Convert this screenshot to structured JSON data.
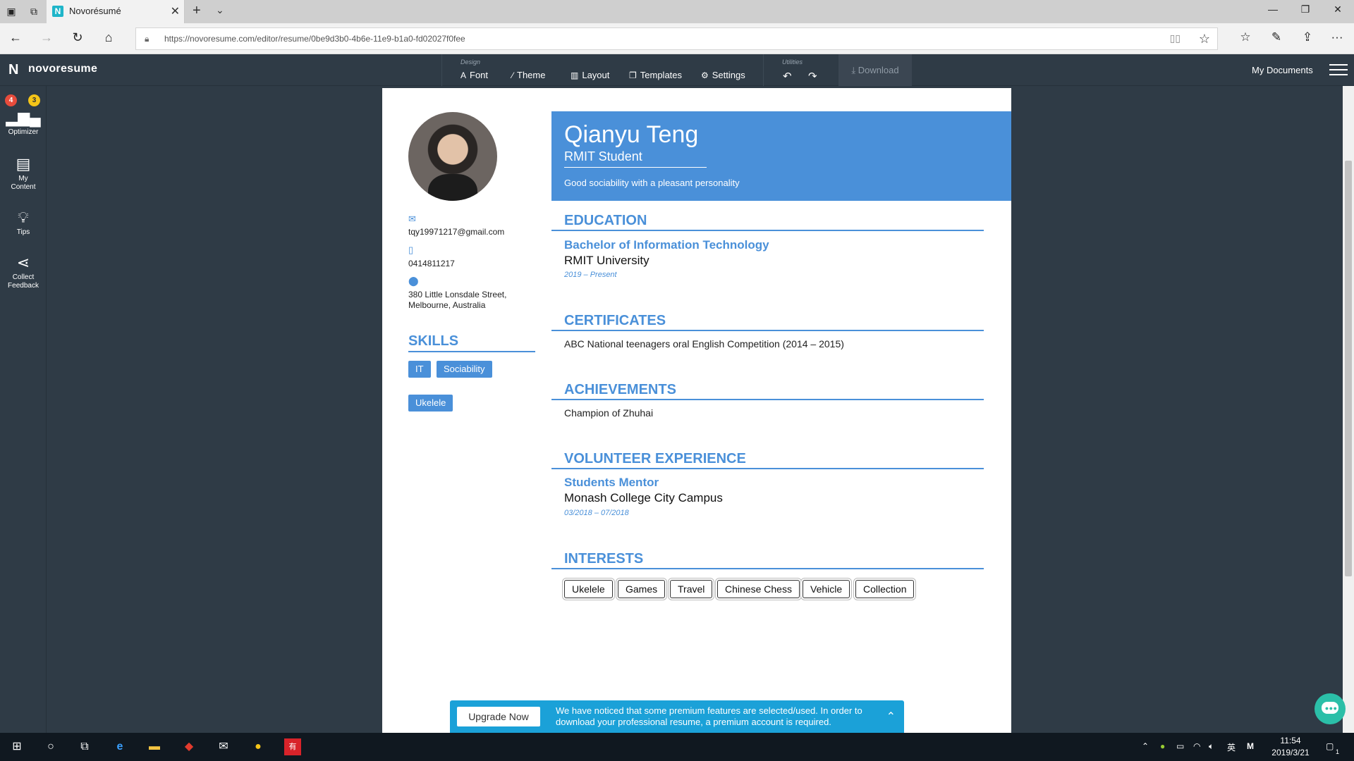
{
  "browser": {
    "tab_title": "Novorésumé",
    "url": "https://novoresume.com/editor/resume/0be9d3b0-4b6e-11e9-b1a0-fd02027f0fee"
  },
  "app": {
    "brand": "novoresume",
    "toolbar": {
      "design_label": "Design",
      "font": "Font",
      "theme": "Theme",
      "layout": "Layout",
      "templates": "Templates",
      "settings": "Settings",
      "utilities_label": "Utilities",
      "download": "Download"
    },
    "my_documents": "My Documents",
    "sidebar": {
      "badge_red": "4",
      "badge_yellow": "3",
      "items": [
        {
          "label": "Optimizer"
        },
        {
          "label": "My Content"
        },
        {
          "label": "Tips"
        },
        {
          "label": "Collect Feedback"
        }
      ]
    }
  },
  "resume": {
    "name": "Qianyu Teng",
    "role": "RMIT Student",
    "tagline": "Good sociability with a pleasant personality",
    "contact": {
      "email": "tqy19971217@gmail.com",
      "phone": "0414811217",
      "address_line1": "380 Little Lonsdale Street,",
      "address_line2": "Melbourne, Australia"
    },
    "skills_heading": "SKILLS",
    "skills": [
      "IT",
      "Sociability",
      "Ukelele"
    ],
    "education": {
      "heading": "EDUCATION",
      "degree": "Bachelor of Information Technology",
      "school": "RMIT University",
      "dates": "2019 – Present"
    },
    "certificates": {
      "heading": "CERTIFICATES",
      "item": "ABC National teenagers oral English Competition (2014 – 2015)"
    },
    "achievements": {
      "heading": "ACHIEVEMENTS",
      "item": "Champion of Zhuhai"
    },
    "volunteer": {
      "heading": "VOLUNTEER EXPERIENCE",
      "title": "Students Mentor",
      "org": "Monash College City Campus",
      "dates": "03/2018 – 07/2018"
    },
    "interests": {
      "heading": "INTERESTS",
      "items": [
        "Ukelele",
        "Games",
        "Travel",
        "Chinese Chess",
        "Vehicle",
        "Collection"
      ]
    }
  },
  "banner": {
    "button": "Upgrade Now",
    "message": "We have noticed that some premium features are selected/used. In order to download your professional resume, a premium account is required."
  },
  "taskbar": {
    "time": "11:54",
    "date": "2019/3/21",
    "ime": "英",
    "notifications": "1"
  },
  "colors": {
    "accent": "#4a90d9",
    "app_bg": "#2f3b46",
    "banner": "#1ba1d8"
  }
}
